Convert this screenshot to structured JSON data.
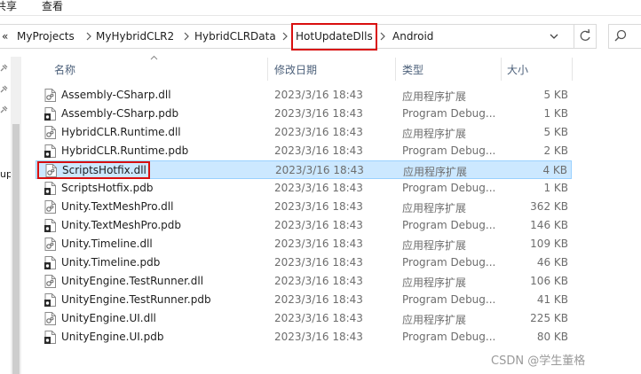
{
  "ribbon": {
    "share_label": "共享",
    "view_label": "查看"
  },
  "address_bar": {
    "back_chevron": "«",
    "crumbs": [
      "MyProjects",
      "MyHybridCLR2",
      "HybridCLRData",
      "HotUpdateDlls",
      "Android"
    ]
  },
  "columns": {
    "name": "名称",
    "date": "修改日期",
    "type": "类型",
    "size": "大小"
  },
  "nav": {
    "partial_label": "up"
  },
  "files": [
    {
      "name": "Assembly-CSharp.dll",
      "date": "2023/3/16 18:43",
      "type": "应用程序扩展",
      "size": "5 KB",
      "icon": "dll-file-icon"
    },
    {
      "name": "Assembly-CSharp.pdb",
      "date": "2023/3/16 18:43",
      "type": "Program Debug...",
      "size": "1 KB",
      "icon": "pdb-file-icon"
    },
    {
      "name": "HybridCLR.Runtime.dll",
      "date": "2023/3/16 18:43",
      "type": "应用程序扩展",
      "size": "5 KB",
      "icon": "dll-file-icon"
    },
    {
      "name": "HybridCLR.Runtime.pdb",
      "date": "2023/3/16 18:43",
      "type": "Program Debug...",
      "size": "2 KB",
      "icon": "pdb-file-icon"
    },
    {
      "name": "ScriptsHotfix.dll",
      "date": "2023/3/16 18:43",
      "type": "应用程序扩展",
      "size": "4 KB",
      "icon": "dll-file-icon",
      "selected": true
    },
    {
      "name": "ScriptsHotfix.pdb",
      "date": "2023/3/16 18:43",
      "type": "Program Debug...",
      "size": "1 KB",
      "icon": "pdb-file-icon"
    },
    {
      "name": "Unity.TextMeshPro.dll",
      "date": "2023/3/16 18:43",
      "type": "应用程序扩展",
      "size": "362 KB",
      "icon": "dll-file-icon"
    },
    {
      "name": "Unity.TextMeshPro.pdb",
      "date": "2023/3/16 18:43",
      "type": "Program Debug...",
      "size": "146 KB",
      "icon": "pdb-file-icon"
    },
    {
      "name": "Unity.Timeline.dll",
      "date": "2023/3/16 18:43",
      "type": "应用程序扩展",
      "size": "109 KB",
      "icon": "dll-file-icon"
    },
    {
      "name": "Unity.Timeline.pdb",
      "date": "2023/3/16 18:43",
      "type": "Program Debug...",
      "size": "46 KB",
      "icon": "pdb-file-icon"
    },
    {
      "name": "UnityEngine.TestRunner.dll",
      "date": "2023/3/16 18:43",
      "type": "应用程序扩展",
      "size": "106 KB",
      "icon": "dll-file-icon"
    },
    {
      "name": "UnityEngine.TestRunner.pdb",
      "date": "2023/3/16 18:43",
      "type": "Program Debug...",
      "size": "41 KB",
      "icon": "pdb-file-icon"
    },
    {
      "name": "UnityEngine.UI.dll",
      "date": "2023/3/16 18:43",
      "type": "应用程序扩展",
      "size": "225 KB",
      "icon": "dll-file-icon"
    },
    {
      "name": "UnityEngine.UI.pdb",
      "date": "2023/3/16 18:43",
      "type": "Program Debug...",
      "size": "80 KB",
      "icon": "pdb-file-icon"
    }
  ],
  "watermark": "CSDN @学生董格",
  "colors": {
    "selection": "#cce8ff",
    "highlight_box": "#d90f0f",
    "header_text": "#4c607a"
  }
}
